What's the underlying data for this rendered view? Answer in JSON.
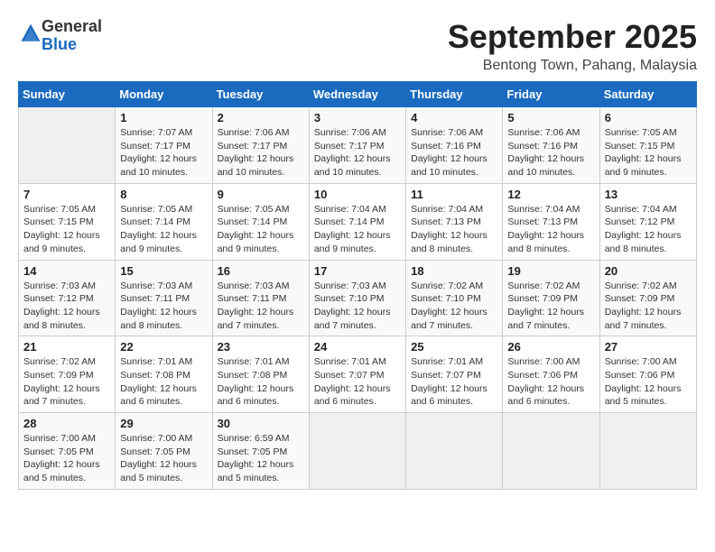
{
  "logo": {
    "general": "General",
    "blue": "Blue"
  },
  "header": {
    "month": "September 2025",
    "location": "Bentong Town, Pahang, Malaysia"
  },
  "days_of_week": [
    "Sunday",
    "Monday",
    "Tuesday",
    "Wednesday",
    "Thursday",
    "Friday",
    "Saturday"
  ],
  "weeks": [
    [
      {
        "day": "",
        "info": ""
      },
      {
        "day": "1",
        "info": "Sunrise: 7:07 AM\nSunset: 7:17 PM\nDaylight: 12 hours\nand 10 minutes."
      },
      {
        "day": "2",
        "info": "Sunrise: 7:06 AM\nSunset: 7:17 PM\nDaylight: 12 hours\nand 10 minutes."
      },
      {
        "day": "3",
        "info": "Sunrise: 7:06 AM\nSunset: 7:17 PM\nDaylight: 12 hours\nand 10 minutes."
      },
      {
        "day": "4",
        "info": "Sunrise: 7:06 AM\nSunset: 7:16 PM\nDaylight: 12 hours\nand 10 minutes."
      },
      {
        "day": "5",
        "info": "Sunrise: 7:06 AM\nSunset: 7:16 PM\nDaylight: 12 hours\nand 10 minutes."
      },
      {
        "day": "6",
        "info": "Sunrise: 7:05 AM\nSunset: 7:15 PM\nDaylight: 12 hours\nand 9 minutes."
      }
    ],
    [
      {
        "day": "7",
        "info": "Sunrise: 7:05 AM\nSunset: 7:15 PM\nDaylight: 12 hours\nand 9 minutes."
      },
      {
        "day": "8",
        "info": "Sunrise: 7:05 AM\nSunset: 7:14 PM\nDaylight: 12 hours\nand 9 minutes."
      },
      {
        "day": "9",
        "info": "Sunrise: 7:05 AM\nSunset: 7:14 PM\nDaylight: 12 hours\nand 9 minutes."
      },
      {
        "day": "10",
        "info": "Sunrise: 7:04 AM\nSunset: 7:14 PM\nDaylight: 12 hours\nand 9 minutes."
      },
      {
        "day": "11",
        "info": "Sunrise: 7:04 AM\nSunset: 7:13 PM\nDaylight: 12 hours\nand 8 minutes."
      },
      {
        "day": "12",
        "info": "Sunrise: 7:04 AM\nSunset: 7:13 PM\nDaylight: 12 hours\nand 8 minutes."
      },
      {
        "day": "13",
        "info": "Sunrise: 7:04 AM\nSunset: 7:12 PM\nDaylight: 12 hours\nand 8 minutes."
      }
    ],
    [
      {
        "day": "14",
        "info": "Sunrise: 7:03 AM\nSunset: 7:12 PM\nDaylight: 12 hours\nand 8 minutes."
      },
      {
        "day": "15",
        "info": "Sunrise: 7:03 AM\nSunset: 7:11 PM\nDaylight: 12 hours\nand 8 minutes."
      },
      {
        "day": "16",
        "info": "Sunrise: 7:03 AM\nSunset: 7:11 PM\nDaylight: 12 hours\nand 7 minutes."
      },
      {
        "day": "17",
        "info": "Sunrise: 7:03 AM\nSunset: 7:10 PM\nDaylight: 12 hours\nand 7 minutes."
      },
      {
        "day": "18",
        "info": "Sunrise: 7:02 AM\nSunset: 7:10 PM\nDaylight: 12 hours\nand 7 minutes."
      },
      {
        "day": "19",
        "info": "Sunrise: 7:02 AM\nSunset: 7:09 PM\nDaylight: 12 hours\nand 7 minutes."
      },
      {
        "day": "20",
        "info": "Sunrise: 7:02 AM\nSunset: 7:09 PM\nDaylight: 12 hours\nand 7 minutes."
      }
    ],
    [
      {
        "day": "21",
        "info": "Sunrise: 7:02 AM\nSunset: 7:09 PM\nDaylight: 12 hours\nand 7 minutes."
      },
      {
        "day": "22",
        "info": "Sunrise: 7:01 AM\nSunset: 7:08 PM\nDaylight: 12 hours\nand 6 minutes."
      },
      {
        "day": "23",
        "info": "Sunrise: 7:01 AM\nSunset: 7:08 PM\nDaylight: 12 hours\nand 6 minutes."
      },
      {
        "day": "24",
        "info": "Sunrise: 7:01 AM\nSunset: 7:07 PM\nDaylight: 12 hours\nand 6 minutes."
      },
      {
        "day": "25",
        "info": "Sunrise: 7:01 AM\nSunset: 7:07 PM\nDaylight: 12 hours\nand 6 minutes."
      },
      {
        "day": "26",
        "info": "Sunrise: 7:00 AM\nSunset: 7:06 PM\nDaylight: 12 hours\nand 6 minutes."
      },
      {
        "day": "27",
        "info": "Sunrise: 7:00 AM\nSunset: 7:06 PM\nDaylight: 12 hours\nand 5 minutes."
      }
    ],
    [
      {
        "day": "28",
        "info": "Sunrise: 7:00 AM\nSunset: 7:05 PM\nDaylight: 12 hours\nand 5 minutes."
      },
      {
        "day": "29",
        "info": "Sunrise: 7:00 AM\nSunset: 7:05 PM\nDaylight: 12 hours\nand 5 minutes."
      },
      {
        "day": "30",
        "info": "Sunrise: 6:59 AM\nSunset: 7:05 PM\nDaylight: 12 hours\nand 5 minutes."
      },
      {
        "day": "",
        "info": ""
      },
      {
        "day": "",
        "info": ""
      },
      {
        "day": "",
        "info": ""
      },
      {
        "day": "",
        "info": ""
      }
    ]
  ]
}
